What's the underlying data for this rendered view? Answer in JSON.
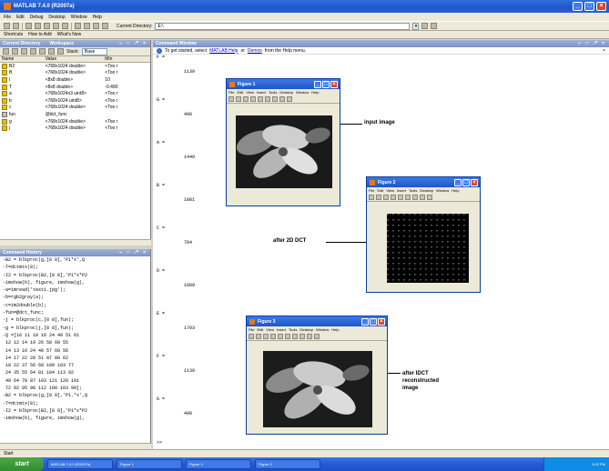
{
  "window": {
    "title": "MATLAB 7.4.0 (R2007a)"
  },
  "menu": [
    "File",
    "Edit",
    "Debug",
    "Desktop",
    "Window",
    "Help"
  ],
  "toolbar": {
    "current_dir_label": "Current Directory:",
    "current_dir_value": "E:\\"
  },
  "shortcuts": [
    "Shortcuts",
    "How to Add",
    "What's New"
  ],
  "workspace": {
    "title_left": "Current Directory",
    "title_right": "Workspace",
    "stack_label": "Stack:",
    "stack_value": "Base",
    "columns": [
      "Name",
      "Value",
      "Min"
    ],
    "rows": [
      {
        "name": "B2",
        "value": "<768x1024 double>",
        "min": "<Too r"
      },
      {
        "name": "B",
        "value": "<768x1024 double>",
        "min": "<Too r"
      },
      {
        "name": "I",
        "value": "<8x8 double>",
        "min": "10"
      },
      {
        "name": "T",
        "value": "<8x8 double>",
        "min": "-0.490"
      },
      {
        "name": "a",
        "value": "<768x1024x3 uint8>",
        "min": "<Too r"
      },
      {
        "name": "b",
        "value": "<768x1024 uint8>",
        "min": "<Too r"
      },
      {
        "name": "c",
        "value": "<768x1024 double>",
        "min": "<Too r"
      },
      {
        "name": "fun",
        "value": "@dct_func",
        "min": ""
      },
      {
        "name": "g",
        "value": "<768x1024 double>",
        "min": "<Too r"
      },
      {
        "name": "j",
        "value": "<768x1024 double>",
        "min": "<Too r"
      }
    ]
  },
  "history": {
    "title": "Command History",
    "lines": [
      "-B2 = blkproc(g,[8 8],'P1*x',Q",
      "-T=dctmtx(8);",
      "-I2 = blkproc(B2,[8 8],'P1*x*P2",
      "-imshow(b), figure, imshow(g), ",
      "-a=imread('test1.jpg');",
      "-b=rgb2gray(a);",
      "-c=im2double(b);",
      "-fun=@dct_func;",
      "-j = blkproc(c,[8 8],fun);",
      "-g = blkproc(j,[8 8],fun);",
      "-Q =[16 11 10 16 24 40 51 61",
      " 12 12 14 19 26 58 60 55",
      " 14 13 16 24 40 57 69 56",
      " 14 17 22 29 51 87 80 62",
      " 18 22 37 56 68 109 103 77",
      " 24 35 55 64 81 104 113 92",
      " 49 64 78 87 103 121 120 101",
      " 72 92 95 98 112 100 103 99];",
      "-B2 = blkproc(g,[8 8],'P1.*x',Q",
      "-T=dctmtx(8);",
      "-I2 = blkproc(B2,[8 8],'P1*x*P2",
      "-imshow(b), figure, imshow(g), "
    ]
  },
  "command_window": {
    "title": "Command Window",
    "info_prefix": "To get started, select",
    "help_link": "MATLAB Help",
    "or": "or",
    "demos_link": "Demos",
    "info_suffix": "from the Help menu.",
    "prompt": ">>",
    "outputs": [
      {
        "var": "F =",
        "val": "1139"
      },
      {
        "var": "G =",
        "val": "400"
      },
      {
        "var": "A =",
        "val": "1449"
      },
      {
        "var": "B =",
        "val": "1881"
      },
      {
        "var": "C =",
        "val": "784"
      },
      {
        "var": "D =",
        "val": "1009"
      },
      {
        "var": "E =",
        "val": "1703"
      },
      {
        "var": "F =",
        "val": "1139"
      },
      {
        "var": "G =",
        "val": "400"
      }
    ]
  },
  "figures": [
    {
      "title": "Figure 1",
      "annotation": "input image"
    },
    {
      "title": "Figure 2",
      "annotation": "after 2D DCT"
    },
    {
      "title": "Figure 3",
      "annotation_lines": [
        "after IDCT",
        "reconstructed",
        "image"
      ]
    }
  ],
  "figure_menu": [
    "File",
    "Edit",
    "View",
    "Insert",
    "Tools",
    "Desktop",
    "Window",
    "Help"
  ],
  "status": {
    "start_label": "Start"
  },
  "taskbar": {
    "start": "start",
    "tasks": [
      "MATLAB 7.4.0 (R2007a)",
      "Figure 1",
      "Figure 2",
      "Figure 3"
    ],
    "clock": "3:02 PM"
  }
}
